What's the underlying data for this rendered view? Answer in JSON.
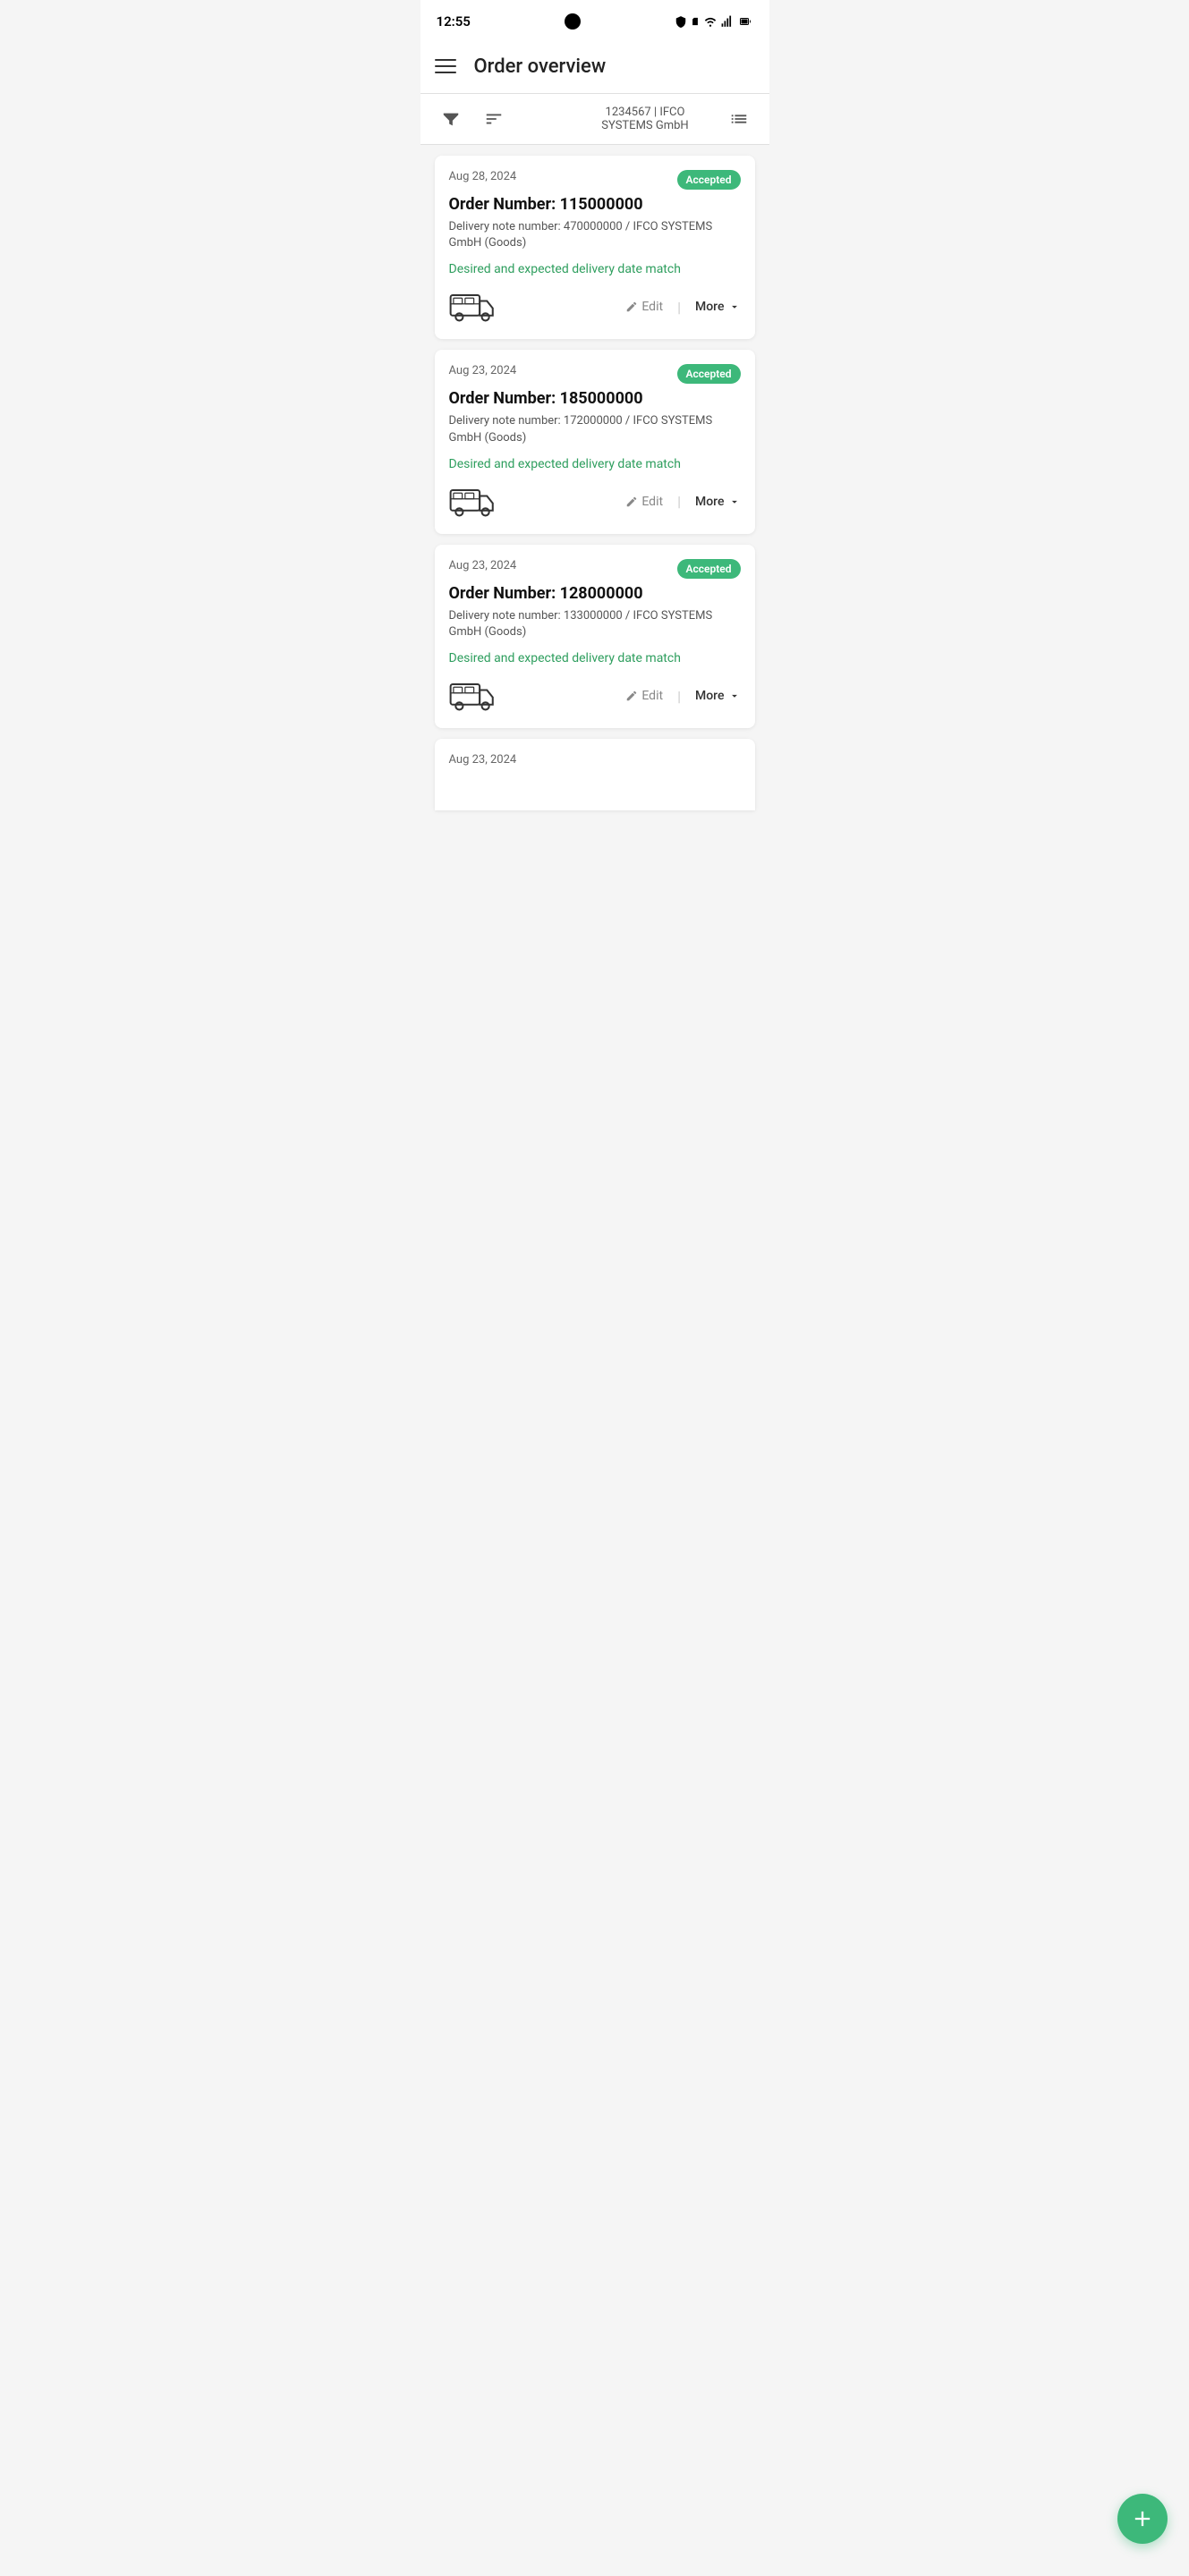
{
  "statusBar": {
    "time": "12:55",
    "icons": [
      "shield",
      "sim",
      "wifi",
      "signal",
      "battery"
    ]
  },
  "header": {
    "title": "Order overview"
  },
  "toolbar": {
    "companyId": "1234567 | IFCO",
    "companyName": "SYSTEMS GmbH"
  },
  "orders": [
    {
      "id": "order-1",
      "date": "Aug 28, 2024",
      "orderNumber": "Order Number: 115000000",
      "deliveryNote": "Delivery note number: 470000000 / IFCO SYSTEMS GmbH (Goods)",
      "deliveryMatch": "Desired and expected delivery date match",
      "status": "Accepted",
      "editLabel": "Edit",
      "moreLabel": "More"
    },
    {
      "id": "order-2",
      "date": "Aug 23, 2024",
      "orderNumber": "Order Number: 185000000",
      "deliveryNote": "Delivery note number: 172000000 / IFCO SYSTEMS GmbH (Goods)",
      "deliveryMatch": "Desired and expected delivery date match",
      "status": "Accepted",
      "editLabel": "Edit",
      "moreLabel": "More"
    },
    {
      "id": "order-3",
      "date": "Aug 23, 2024",
      "orderNumber": "Order Number: 128000000",
      "deliveryNote": "Delivery note number: 133000000 / IFCO SYSTEMS GmbH (Goods)",
      "deliveryMatch": "Desired and expected delivery date match",
      "status": "Accepted",
      "editLabel": "Edit",
      "moreLabel": "More"
    },
    {
      "id": "order-4",
      "date": "Aug 23, 2024",
      "orderNumber": "",
      "deliveryNote": "",
      "deliveryMatch": "",
      "status": "",
      "editLabel": "",
      "moreLabel": ""
    }
  ],
  "fab": {
    "label": "Add order"
  }
}
